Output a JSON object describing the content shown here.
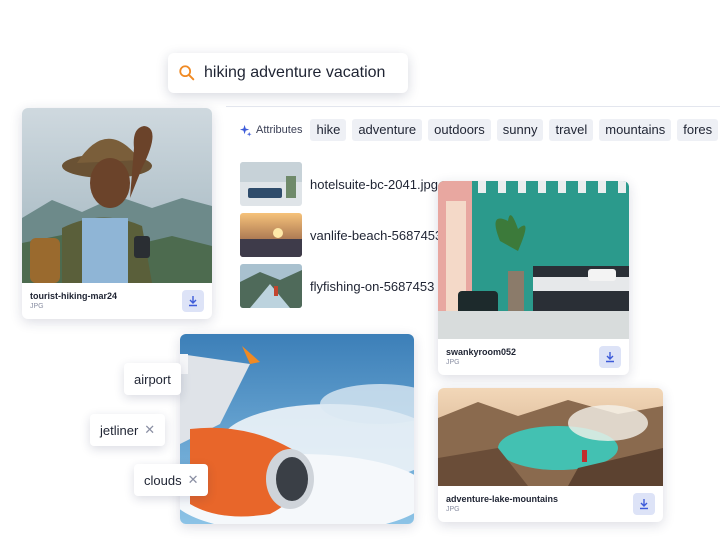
{
  "search": {
    "query": "hiking adventure vacation",
    "icon": "search-icon",
    "icon_color": "#f08a24"
  },
  "attributes": {
    "label": "Attributes",
    "icon": "sparkle-icon",
    "chips": [
      "hike",
      "adventure",
      "outdoors",
      "sunny",
      "travel",
      "mountains",
      "fores"
    ]
  },
  "cards": {
    "hiker": {
      "filename": "tourist-hiking-mar24",
      "type": "JPG"
    },
    "room": {
      "filename": "swankyroom052",
      "type": "JPG"
    },
    "lake": {
      "filename": "adventure-lake-mountains",
      "type": "JPG"
    }
  },
  "file_list": [
    {
      "name": "hotelsuite-bc-2041.jpg"
    },
    {
      "name": "vanlife-beach-5687453"
    },
    {
      "name": "flyfishing-on-5687453"
    }
  ],
  "tags": [
    {
      "label": "airport",
      "removable": false
    },
    {
      "label": "jetliner",
      "removable": true
    },
    {
      "label": "clouds",
      "removable": true
    }
  ],
  "colors": {
    "accent": "#3d5bd9",
    "download_bg": "#dde3f7"
  }
}
